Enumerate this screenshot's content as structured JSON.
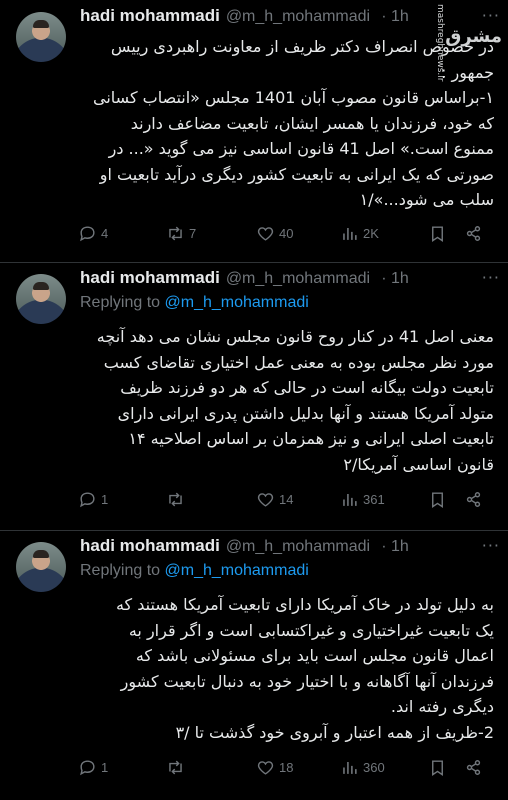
{
  "watermark": {
    "logo": "مشرق",
    "site": "mashreghnews.ir"
  },
  "tweets": [
    {
      "name": "hadi mohammadi",
      "handle": "@m_h_mohammadi",
      "time": "· 1h",
      "replying_label": "",
      "replying_to": "",
      "lines": [
        "در خصوص انصراف دکتر ظریف از معاونت راهبردی رییس",
        "جمهور :",
        "۱-براساس قانون مصوب آبان 1401 مجلس «انتصاب کسانی",
        "که خود، فرزندان یا همسر ایشان، تابعیت مضاعف دارند",
        "ممنوع است.» اصل 41 قانون اساسی نیز می گوید «... در",
        "صورتی که یک ایرانی به تابعیت کشور دیگری درآید تابعیت او",
        "سلب می شود...»/۱"
      ],
      "stats": {
        "replies": "4",
        "reposts": "7",
        "likes": "40",
        "views": "2K"
      }
    },
    {
      "name": "hadi mohammadi",
      "handle": "@m_h_mohammadi",
      "time": "· 1h",
      "replying_label": "Replying to",
      "replying_to": "@m_h_mohammadi",
      "lines": [
        "معنی اصل 41 در کنار روح قانون مجلس نشان می دهد آنچه",
        "مورد نظر مجلس بوده به معنی عمل اختیاری تقاضای کسب",
        "تابعیت دولت بیگانه است در حالی که هر دو فرزند ظریف",
        "متولد آمریکا هستند و آنها بدلیل داشتن پدری ایرانی دارای",
        "تابعیت اصلی ایرانی و نیز همزمان بر اساس اصلاحیه ۱۴",
        "قانون اساسی آمریکا/۲"
      ],
      "stats": {
        "replies": "1",
        "reposts": "",
        "likes": "14",
        "views": "361"
      }
    },
    {
      "name": "hadi mohammadi",
      "handle": "@m_h_mohammadi",
      "time": "· 1h",
      "replying_label": "Replying to",
      "replying_to": "@m_h_mohammadi",
      "lines": [
        "به دلیل تولد در خاک آمریکا دارای تابعیت آمریکا هستند که",
        "یک تابعیت غیراختیاری و غیراکتسابی است و اگر قرار به",
        "اعمال قانون مجلس است باید برای مسئولانی باشد که",
        "فرزندان آنها آگاهانه و با اختیار خود به دنبال تابعیت کشور",
        "دیگری رفته اند.",
        "2-ظریف از همه اعتبار و آبروی خود گذشت تا /۳"
      ],
      "stats": {
        "replies": "1",
        "reposts": "",
        "likes": "18",
        "views": "360"
      }
    }
  ]
}
